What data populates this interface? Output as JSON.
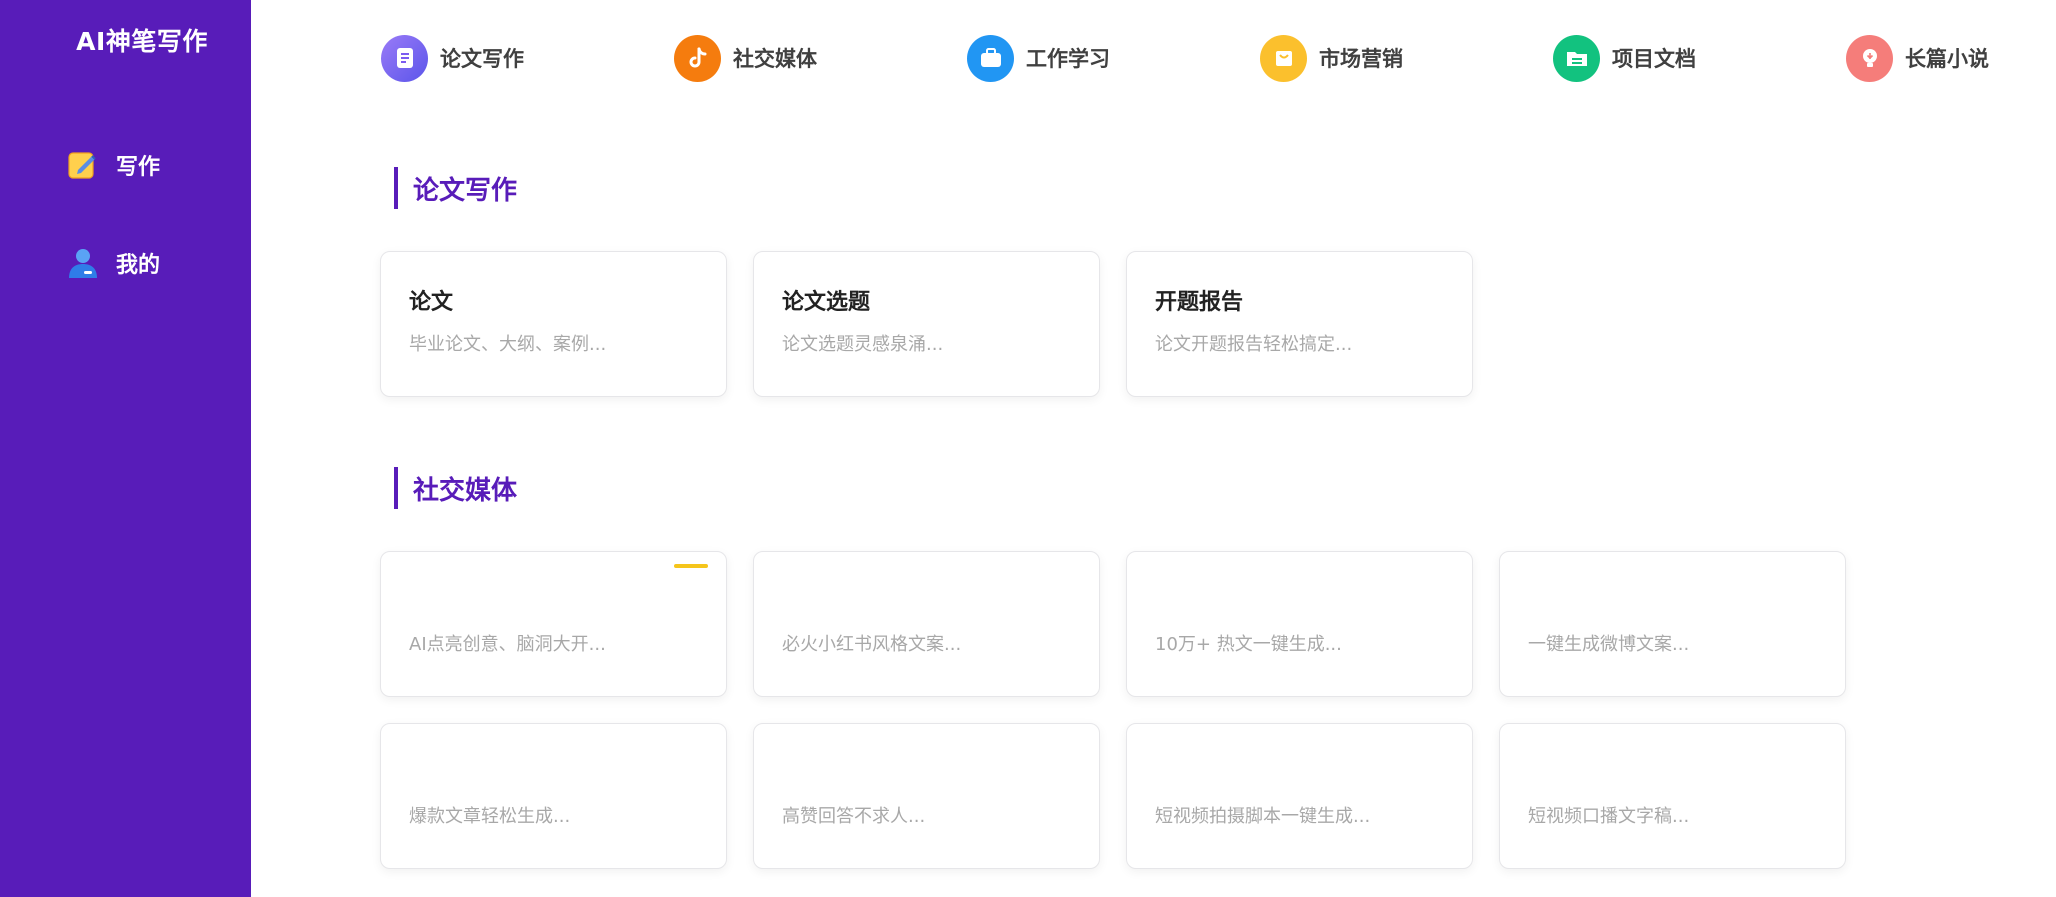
{
  "sidebar": {
    "brand": "AI神笔写作",
    "items": [
      {
        "label": "写作",
        "icon": "pencil-note-icon"
      },
      {
        "label": "我的",
        "icon": "user-icon"
      }
    ]
  },
  "topnav": {
    "items": [
      {
        "label": "论文写作",
        "icon": "document-icon",
        "color": "#7c5cf0"
      },
      {
        "label": "社交媒体",
        "icon": "tiktok-icon",
        "color": "#f57c0e"
      },
      {
        "label": "工作学习",
        "icon": "briefcase-icon",
        "color": "#2196f3"
      },
      {
        "label": "市场营销",
        "icon": "shopping-bag-icon",
        "color": "#fbc02d"
      },
      {
        "label": "项目文档",
        "icon": "folder-icon",
        "color": "#12c27f"
      },
      {
        "label": "长篇小说",
        "icon": "lightbulb-icon",
        "color": "#f57d7a"
      }
    ]
  },
  "sections": [
    {
      "title": "论文写作",
      "cards": [
        {
          "title": "论文",
          "desc": "毕业论文、大纲、案例..."
        },
        {
          "title": "论文选题",
          "desc": "论文选题灵感泉涌..."
        },
        {
          "title": "开题报告",
          "desc": "论文开题报告轻松搞定..."
        }
      ]
    },
    {
      "title": "社交媒体",
      "cards": [
        {
          "title": "",
          "desc": "AI点亮创意、脑洞大开..."
        },
        {
          "title": "",
          "desc": "必火小红书风格文案..."
        },
        {
          "title": "",
          "desc": "10万+ 热文一键生成..."
        },
        {
          "title": "",
          "desc": "一键生成微博文案..."
        },
        {
          "title": "",
          "desc": "爆款文章轻松生成..."
        },
        {
          "title": "",
          "desc": "高赞回答不求人..."
        },
        {
          "title": "",
          "desc": "短视频拍摄脚本一键生成..."
        },
        {
          "title": "",
          "desc": "短视频口播文字稿..."
        }
      ]
    }
  ],
  "colors": {
    "sidebar_bg": "#581cb9",
    "accent": "#581cb9",
    "card_desc": "#a8a8a8"
  }
}
